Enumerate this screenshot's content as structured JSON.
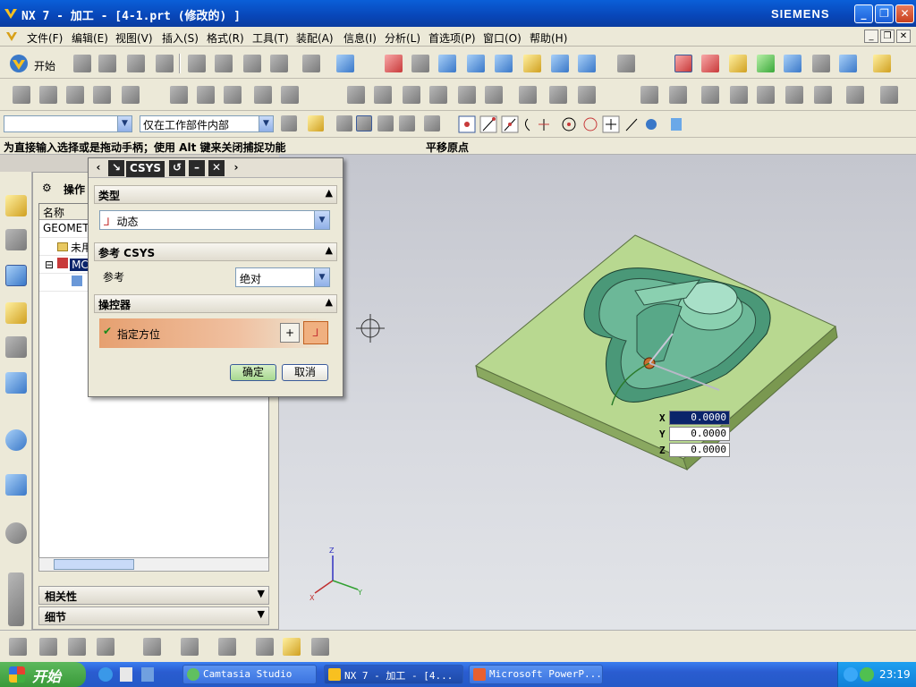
{
  "window": {
    "title": "NX 7 - 加工 - [4-1.prt  (修改的) ]",
    "brand": "SIEMENS",
    "btn_min": "_",
    "btn_restore": "❐",
    "btn_close": "✕"
  },
  "menu": [
    "文件(F)",
    "编辑(E)",
    "视图(V)",
    "插入(S)",
    "格式(R)",
    "工具(T)",
    "装配(A)",
    "信息(I)",
    "分析(L)",
    "首选项(P)",
    "窗口(O)",
    "帮助(H)"
  ],
  "toolbar": {
    "start_label": "开始",
    "selection_scope": "仅在工作部件内部",
    "filter_value": ""
  },
  "status": {
    "prompt": "为直接输入选择或是拖动手柄；使用 Alt 键来关闭捕捉功能",
    "message": "平移原点"
  },
  "navigator": {
    "title": "操作",
    "column_name": "名称",
    "rows": [
      {
        "label": "GEOMETR"
      },
      {
        "label": "未用"
      },
      {
        "label": "MC"
      },
      {
        "label": ""
      }
    ],
    "panel_dependencies": "相关性",
    "panel_details": "细节"
  },
  "dialog": {
    "title": "CSYS",
    "section_type": "类型",
    "type_value": "动态",
    "section_ref": "参考 CSYS",
    "ref_label": "参考",
    "ref_value": "绝对",
    "section_manip": "操控器",
    "orient_label": "指定方位",
    "ok": "确定",
    "cancel": "取消"
  },
  "coords": {
    "x_label": "X",
    "x_value": "0.0000",
    "y_label": "Y",
    "y_value": "0.0000",
    "z_label": "Z",
    "z_value": "0.0000"
  },
  "triad": {
    "x": "X",
    "y": "Y",
    "z": "Z"
  },
  "taskbar": {
    "start": "开始",
    "tasks": [
      "Camtasia Studio",
      "NX 7 - 加工 - [4...",
      "Microsoft PowerP..."
    ],
    "clock": "23:19"
  },
  "colors": {
    "title_bar": "#0846b8",
    "part_top": "#b8d890",
    "part_side": "#7a9850",
    "cavity": "#4a9878",
    "orient_highlight": "#e6a070"
  }
}
